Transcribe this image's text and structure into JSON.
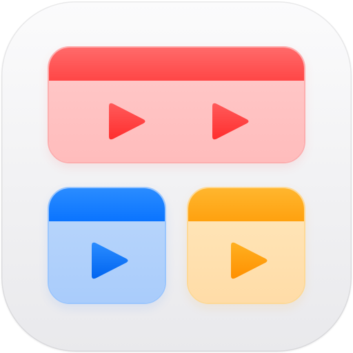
{
  "app_icon": {
    "name": "video-library-app-icon",
    "background_color": "#f2f2f4",
    "cards": [
      {
        "name": "red-wide-card",
        "header_color": "#ff4f4f",
        "body_color": "#ffc0c0",
        "play_color": "#ff3b3b",
        "play_icon_count": 2
      },
      {
        "name": "blue-card",
        "header_color": "#1580ff",
        "body_color": "#aecff9",
        "play_color": "#0a74ff",
        "play_icon_count": 1
      },
      {
        "name": "orange-card",
        "header_color": "#ffaa1c",
        "body_color": "#ffe0ad",
        "play_color": "#ff9a00",
        "play_icon_count": 1
      }
    ],
    "icons": [
      "play-icon"
    ]
  }
}
